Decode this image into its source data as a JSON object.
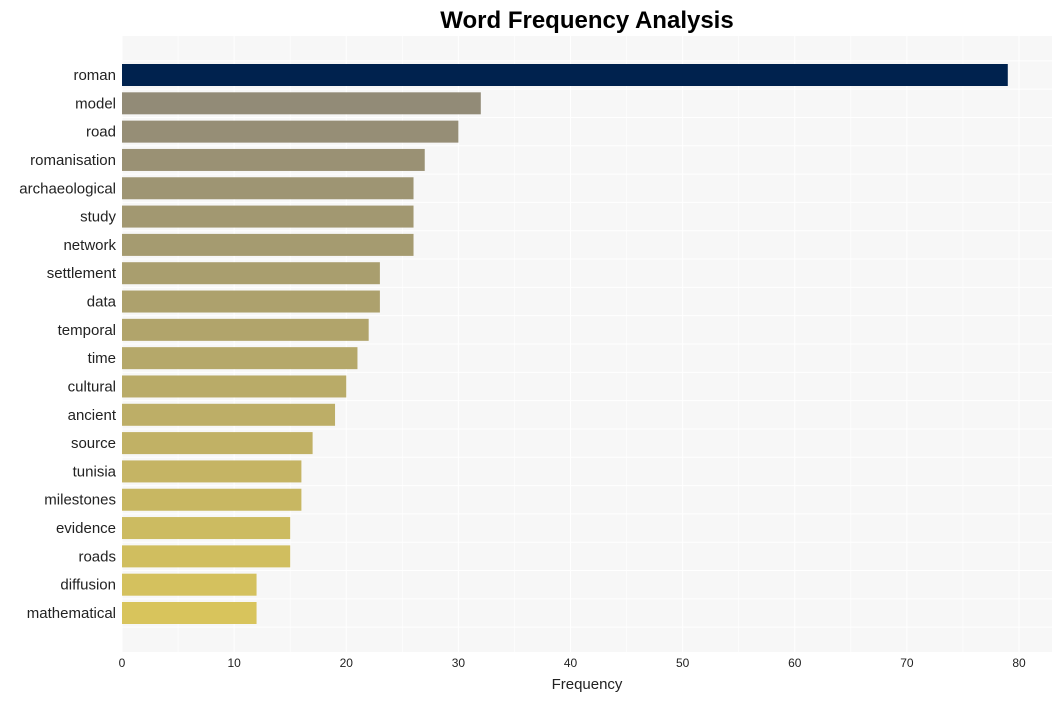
{
  "chart_data": {
    "type": "bar",
    "orientation": "horizontal",
    "title": "Word Frequency Analysis",
    "xlabel": "Frequency",
    "ylabel": "",
    "xlim": [
      0,
      83
    ],
    "xticks": [
      0,
      10,
      20,
      30,
      40,
      50,
      60,
      70,
      80
    ],
    "grid": true,
    "categories": [
      "roman",
      "model",
      "road",
      "romanisation",
      "archaeological",
      "study",
      "network",
      "settlement",
      "data",
      "temporal",
      "time",
      "cultural",
      "ancient",
      "source",
      "tunisia",
      "milestones",
      "evidence",
      "roads",
      "diffusion",
      "mathematical"
    ],
    "values": [
      79,
      32,
      30,
      27,
      26,
      26,
      26,
      23,
      23,
      22,
      21,
      20,
      19,
      17,
      16,
      16,
      15,
      15,
      12,
      12
    ],
    "colors": {
      "highlight": "#00224e",
      "gradient_start": "#928b77",
      "gradient_end": "#d8c45c",
      "plot_background": "#f7f7f7",
      "grid": "#ffffff"
    }
  }
}
